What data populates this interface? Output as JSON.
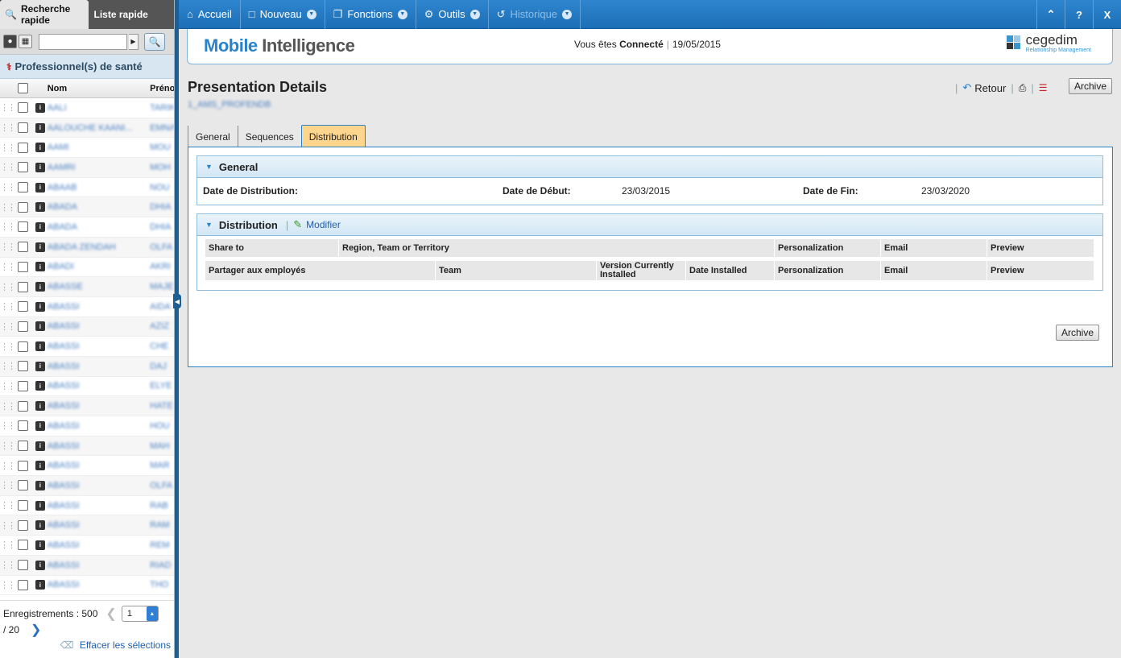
{
  "left_panel": {
    "tabs": [
      {
        "label": "Recherche rapide",
        "active": true
      },
      {
        "label": "Liste rapide",
        "active": false
      }
    ],
    "search": {
      "value": "",
      "placeholder": ""
    },
    "section_title": "Professionnel(s) de santé",
    "columns": {
      "nom": "Nom",
      "prenom": "Prénom"
    },
    "rows": [
      {
        "nom": "AALI",
        "prenom": "TARIK"
      },
      {
        "nom": "AALOUCHE KAANI...",
        "prenom": "EMNA"
      },
      {
        "nom": "AAMI",
        "prenom": "MOU"
      },
      {
        "nom": "AAMRI",
        "prenom": "MOH"
      },
      {
        "nom": "ABAAB",
        "prenom": "NOU"
      },
      {
        "nom": "ABADA",
        "prenom": "DHIA"
      },
      {
        "nom": "ABADA",
        "prenom": "DHIA"
      },
      {
        "nom": "ABADA ZENDAH",
        "prenom": "OLFA"
      },
      {
        "nom": "ABADI",
        "prenom": "AKRI"
      },
      {
        "nom": "ABASSE",
        "prenom": "MAJE"
      },
      {
        "nom": "ABASSI",
        "prenom": "AIDA"
      },
      {
        "nom": "ABASSI",
        "prenom": "AZIZ"
      },
      {
        "nom": "ABASSI",
        "prenom": "CHE"
      },
      {
        "nom": "ABASSI",
        "prenom": "DAJ"
      },
      {
        "nom": "ABASSI",
        "prenom": "ELYE"
      },
      {
        "nom": "ABASSI",
        "prenom": "HATE"
      },
      {
        "nom": "ABASSI",
        "prenom": "HOU"
      },
      {
        "nom": "ABASSI",
        "prenom": "MAH"
      },
      {
        "nom": "ABASSI",
        "prenom": "MAR"
      },
      {
        "nom": "ABASSI",
        "prenom": "OLFA"
      },
      {
        "nom": "ABASSI",
        "prenom": "RAB"
      },
      {
        "nom": "ABASSI",
        "prenom": "RAM"
      },
      {
        "nom": "ABASSI",
        "prenom": "REM"
      },
      {
        "nom": "ABASSI",
        "prenom": "RIAD"
      },
      {
        "nom": "ABASSI",
        "prenom": "THO"
      }
    ],
    "pager": {
      "records_label": "Enregistrements : 500",
      "current_page": "1",
      "total_pages": "/ 20",
      "clear_label": "Effacer les sélections"
    }
  },
  "nav": {
    "items": [
      {
        "label": "Accueil",
        "icon": "home-icon"
      },
      {
        "label": "Nouveau",
        "icon": "document-icon"
      },
      {
        "label": "Fonctions",
        "icon": "files-icon"
      },
      {
        "label": "Outils",
        "icon": "gear-icon"
      },
      {
        "label": "Historique",
        "icon": "history-icon",
        "disabled": true
      }
    ],
    "right_buttons": [
      "^",
      "?",
      "X"
    ]
  },
  "banner": {
    "brand_part1": "Mobile",
    "brand_part2": "Intelligence",
    "status_prefix": "Vous êtes",
    "status_value": "Connecté",
    "date": "19/05/2015",
    "company": "cegedim",
    "company_tagline": "Relationship Management"
  },
  "page": {
    "title": "Presentation Details",
    "subtitle": "1_AMS_PROFENDB",
    "retour_label": "Retour",
    "archive_label": "Archive"
  },
  "tabs": [
    {
      "label": "General",
      "active": false
    },
    {
      "label": "Sequences",
      "active": false
    },
    {
      "label": "Distribution",
      "active": true
    }
  ],
  "general_section": {
    "title": "General",
    "date_distribution_label": "Date de Distribution:",
    "date_distribution_value": "",
    "date_debut_label": "Date de Début:",
    "date_debut_value": "23/03/2015",
    "date_fin_label": "Date de Fin:",
    "date_fin_value": "23/03/2020"
  },
  "distribution_section": {
    "title": "Distribution",
    "modifier_label": "Modifier",
    "table1_headers": [
      "Share to",
      "Region, Team or Territory",
      "Personalization",
      "Email",
      "Preview"
    ],
    "table2_headers": [
      "Partager aux employés",
      "Team",
      "Version Currently Installed",
      "Date Installed",
      "Personalization",
      "Email",
      "Preview"
    ]
  },
  "bottom": {
    "archive_label": "Archive"
  },
  "colors": {
    "nav_blue": "#1c6fb6",
    "active_tab": "#fdd58c",
    "link": "#1f5fae"
  }
}
